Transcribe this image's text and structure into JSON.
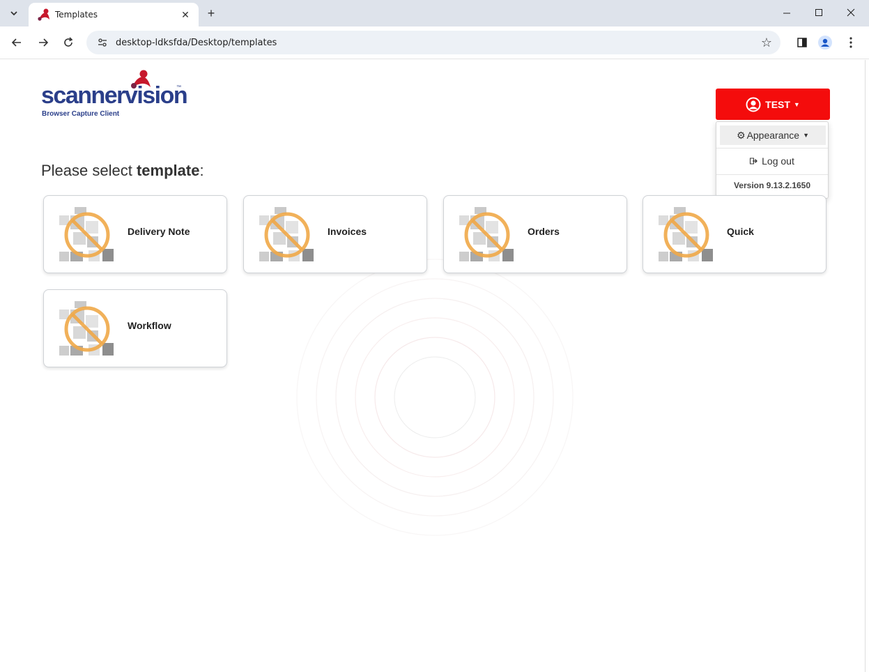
{
  "browser": {
    "tab_title": "Templates",
    "url": "desktop-ldksfda/Desktop/templates"
  },
  "app": {
    "logo_text": "scannervision",
    "logo_tm": "™",
    "logo_subtitle": "Browser Capture Client",
    "brand_color": "#f40c0c",
    "logo_color": "#2b3f8a"
  },
  "user_menu": {
    "username": "TEST",
    "appearance_label": "Appearance",
    "logout_label": "Log out",
    "version": "Version 9.13.2.1650"
  },
  "heading": {
    "prefix": "Please select ",
    "bold": "template",
    "suffix": ":"
  },
  "templates": [
    {
      "name": "Delivery Note",
      "icon": "no-image-icon"
    },
    {
      "name": "Invoices",
      "icon": "no-image-icon"
    },
    {
      "name": "Orders",
      "icon": "no-image-icon"
    },
    {
      "name": "Quick",
      "icon": "no-image-icon"
    },
    {
      "name": "Workflow",
      "icon": "no-image-icon"
    }
  ]
}
